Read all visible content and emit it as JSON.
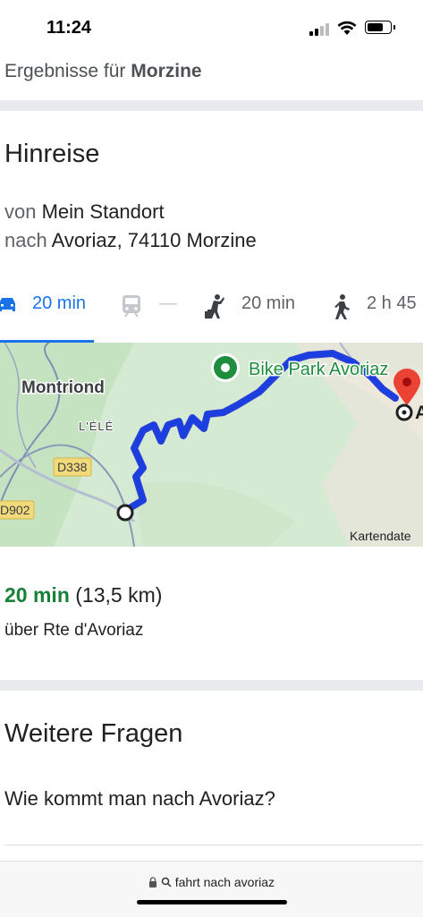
{
  "status_bar": {
    "time": "11:24"
  },
  "results_header": {
    "prefix": "Ergebnisse für ",
    "query": "Morzine"
  },
  "directions": {
    "title": "Hinreise",
    "from_prefix": "von",
    "from_value": "Mein Standort",
    "to_prefix": "nach",
    "to_value": "Avoriaz, 74110 Morzine",
    "modes": [
      {
        "icon": "car-icon",
        "label": "20 min",
        "active": true
      },
      {
        "icon": "train-icon",
        "label": "—",
        "active": false
      },
      {
        "icon": "cycling-hiking-icon",
        "label": "20 min",
        "active": false
      },
      {
        "icon": "walking-icon",
        "label": "2 h 45",
        "active": false
      }
    ]
  },
  "map": {
    "labels": {
      "montriond": "Montriond",
      "lele": "L'ÉLÉ",
      "poi": "Bike Park Avoriaz",
      "road1": "D338",
      "road2": "D902",
      "attribution": "Kartendate",
      "dest_partial": "A"
    },
    "colors": {
      "route": "#1a3fe0",
      "poi": "#1e8e3e",
      "destination_pin": "#ea4335"
    }
  },
  "summary": {
    "duration": "20 min",
    "distance": "(13,5 km)",
    "via": "über Rte d'Avoriaz"
  },
  "more_questions": {
    "title": "Weitere Fragen",
    "question_1": "Wie kommt man nach Avoriaz?"
  },
  "url_bar": {
    "text": "fahrt nach avoriaz"
  }
}
